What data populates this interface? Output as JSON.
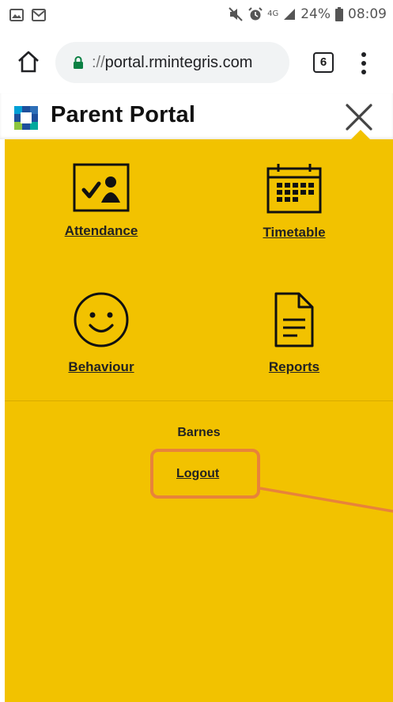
{
  "status_bar": {
    "network": "4G",
    "battery": "24%",
    "time": "08:09"
  },
  "browser": {
    "url_scheme": "://",
    "url_host": "portal.rmintegris.com",
    "tab_count": "6"
  },
  "app": {
    "title": "Parent Portal"
  },
  "menu": {
    "items": [
      {
        "label": "Attendance",
        "icon": "attendance-icon"
      },
      {
        "label": "Timetable",
        "icon": "calendar-icon"
      },
      {
        "label": "Behaviour",
        "icon": "smiley-icon"
      },
      {
        "label": "Reports",
        "icon": "document-icon"
      }
    ],
    "user_name": "Barnes",
    "logout_label": "Logout"
  },
  "colors": {
    "menu_background": "#f2c200",
    "highlight": "#e8833a"
  }
}
